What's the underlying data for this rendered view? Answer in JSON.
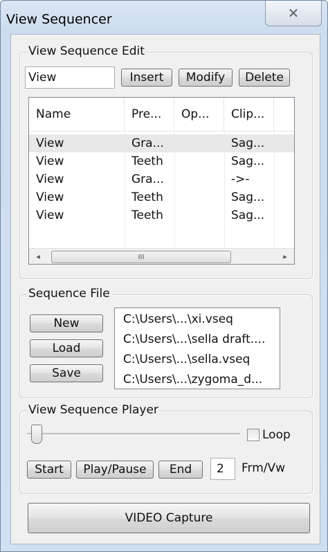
{
  "window": {
    "title": "View Sequencer",
    "close_glyph": "✕"
  },
  "edit_group": {
    "legend": "View Sequence Edit",
    "name_value": "View",
    "insert_label": "Insert",
    "modify_label": "Modify",
    "delete_label": "Delete",
    "columns": [
      "Name",
      "Pre...",
      "Op...",
      "Clip..."
    ],
    "rows": [
      [
        "View",
        "Gra...",
        "",
        "Sag..."
      ],
      [
        "View",
        "Teeth",
        "",
        "Sag..."
      ],
      [
        "View",
        "Gra...",
        "",
        "->-"
      ],
      [
        "View",
        "Teeth",
        "",
        "Sag..."
      ],
      [
        "View",
        "Teeth",
        "",
        "Sag..."
      ]
    ],
    "scroll_left": "◂",
    "scroll_right": "▸",
    "scroll_grip": "III"
  },
  "file_group": {
    "legend": "Sequence File",
    "new_label": "New",
    "load_label": "Load",
    "save_label": "Save",
    "files": [
      "C:\\Users\\...\\xi.vseq",
      "C:\\Users\\...\\sella draft....",
      "C:\\Users\\...\\sella.vseq",
      "C:\\Users\\...\\zygoma_d..."
    ]
  },
  "player_group": {
    "legend": "View Sequence Player",
    "loop_label": "Loop",
    "start_label": "Start",
    "playpause_label": "Play/Pause",
    "end_label": "End",
    "frames_value": "2",
    "frames_unit": "Frm/Vw"
  },
  "video_capture_label": "VIDEO Capture"
}
